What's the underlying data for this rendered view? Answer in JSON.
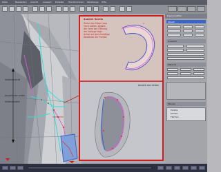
{
  "menubar": {
    "items": [
      "Datei",
      "Bearbeiten",
      "Ansicht",
      "Auswahl",
      "Erstellen",
      "Transformieren",
      "Werkzeuge",
      "Hilfe"
    ]
  },
  "viewport": {
    "left_annotations": {
      "label_1": "Vorderansicht",
      "label_2": "Ansicht von unten",
      "label_3": "Seitenansicht"
    },
    "inset_top": {
      "title": "Ansicht: Rechts",
      "body": "Ziehe den Edge Loop\nnach außen, sodass\ndie Form der Öffnung\nder Vorlage folgt.\nAchte auf gleichmäßige\nAbstände der Punkte."
    },
    "inset_bottom": {
      "title": "Ansicht von hinten"
    }
  },
  "panel": {
    "title": "Eigenschaften",
    "section_1": "Objekt",
    "section_2": "Auswahl",
    "section_3": "Material",
    "section_4": "Ebenen",
    "items": [
      "Punkte",
      "Kanten",
      "Flächen"
    ]
  },
  "colors": {
    "annotation_red": "#d31a1a",
    "selection_blue": "#3a64c8",
    "edge_magenta": "#d85ad8",
    "edge_cyan": "#2fe0d8"
  }
}
